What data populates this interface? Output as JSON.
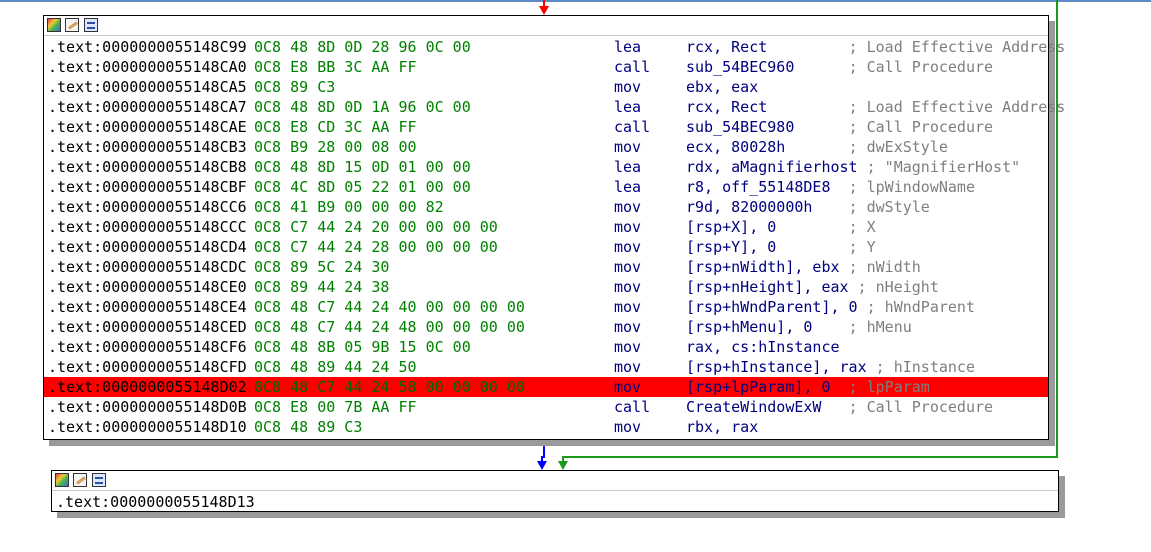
{
  "block1": {
    "lines": [
      {
        "addr": ".text:0000000055148C99",
        "bytes": "0C8 48 8D 0D 28 96 0C 00",
        "mnem": "lea",
        "ops": "rcx, Rect",
        "cmt": "; Load Effective Address"
      },
      {
        "addr": ".text:0000000055148CA0",
        "bytes": "0C8 E8 BB 3C AA FF",
        "mnem": "call",
        "ops": "sub_54BEC960",
        "cmt": "; Call Procedure"
      },
      {
        "addr": ".text:0000000055148CA5",
        "bytes": "0C8 89 C3",
        "mnem": "mov",
        "ops": "ebx, eax",
        "cmt": ""
      },
      {
        "addr": ".text:0000000055148CA7",
        "bytes": "0C8 48 8D 0D 1A 96 0C 00",
        "mnem": "lea",
        "ops": "rcx, Rect",
        "cmt": "; Load Effective Address"
      },
      {
        "addr": ".text:0000000055148CAE",
        "bytes": "0C8 E8 CD 3C AA FF",
        "mnem": "call",
        "ops": "sub_54BEC980",
        "cmt": "; Call Procedure"
      },
      {
        "addr": ".text:0000000055148CB3",
        "bytes": "0C8 B9 28 00 08 00",
        "mnem": "mov",
        "ops": "ecx, 80028h",
        "cmt": "; dwExStyle"
      },
      {
        "addr": ".text:0000000055148CB8",
        "bytes": "0C8 48 8D 15 0D 01 00 00",
        "mnem": "lea",
        "ops": "rdx, aMagnifierhost",
        "cmt": "; \"MagnifierHost\""
      },
      {
        "addr": ".text:0000000055148CBF",
        "bytes": "0C8 4C 8D 05 22 01 00 00",
        "mnem": "lea",
        "ops": "r8, off_55148DE8",
        "cmt": "; lpWindowName"
      },
      {
        "addr": ".text:0000000055148CC6",
        "bytes": "0C8 41 B9 00 00 00 82",
        "mnem": "mov",
        "ops": "r9d, 82000000h",
        "cmt": "; dwStyle"
      },
      {
        "addr": ".text:0000000055148CCC",
        "bytes": "0C8 C7 44 24 20 00 00 00 00",
        "mnem": "mov",
        "ops": "[rsp+X], 0",
        "cmt": "; X"
      },
      {
        "addr": ".text:0000000055148CD4",
        "bytes": "0C8 C7 44 24 28 00 00 00 00",
        "mnem": "mov",
        "ops": "[rsp+Y], 0",
        "cmt": "; Y"
      },
      {
        "addr": ".text:0000000055148CDC",
        "bytes": "0C8 89 5C 24 30",
        "mnem": "mov",
        "ops": "[rsp+nWidth], ebx",
        "cmt": "; nWidth"
      },
      {
        "addr": ".text:0000000055148CE0",
        "bytes": "0C8 89 44 24 38",
        "mnem": "mov",
        "ops": "[rsp+nHeight], eax",
        "cmt": "; nHeight"
      },
      {
        "addr": ".text:0000000055148CE4",
        "bytes": "0C8 48 C7 44 24 40 00 00 00 00",
        "mnem": "mov",
        "ops": "[rsp+hWndParent], 0",
        "cmt": "; hWndParent"
      },
      {
        "addr": ".text:0000000055148CED",
        "bytes": "0C8 48 C7 44 24 48 00 00 00 00",
        "mnem": "mov",
        "ops": "[rsp+hMenu], 0",
        "cmt": "; hMenu"
      },
      {
        "addr": ".text:0000000055148CF6",
        "bytes": "0C8 48 8B 05 9B 15 0C 00",
        "mnem": "mov",
        "ops": "rax, cs:hInstance",
        "cmt": ""
      },
      {
        "addr": ".text:0000000055148CFD",
        "bytes": "0C8 48 89 44 24 50",
        "mnem": "mov",
        "ops": "[rsp+hInstance], rax",
        "cmt": "; hInstance"
      },
      {
        "addr": ".text:0000000055148D02",
        "bytes": "0C8 48 C7 44 24 58 00 00 00 00",
        "mnem": "mov",
        "ops": "[rsp+lpParam], 0",
        "cmt": "; lpParam",
        "selected": true
      },
      {
        "addr": ".text:0000000055148D0B",
        "bytes": "0C8 E8 00 7B AA FF",
        "mnem": "call",
        "ops": "CreateWindowExW",
        "cmt": "; Call Procedure"
      },
      {
        "addr": ".text:0000000055148D10",
        "bytes": "0C8 48 89 C3",
        "mnem": "mov",
        "ops": "rbx, rax",
        "cmt": ""
      }
    ]
  },
  "block2": {
    "partial_line": ".text:0000000055148D13"
  },
  "colors": {
    "selection": "#ff0000",
    "true_edge": "#008000",
    "false_edge": "#0000ff",
    "incoming_edge": "#ff0000",
    "bytes": "#008000",
    "instruction": "#000080",
    "comment": "#7f7f7f"
  }
}
